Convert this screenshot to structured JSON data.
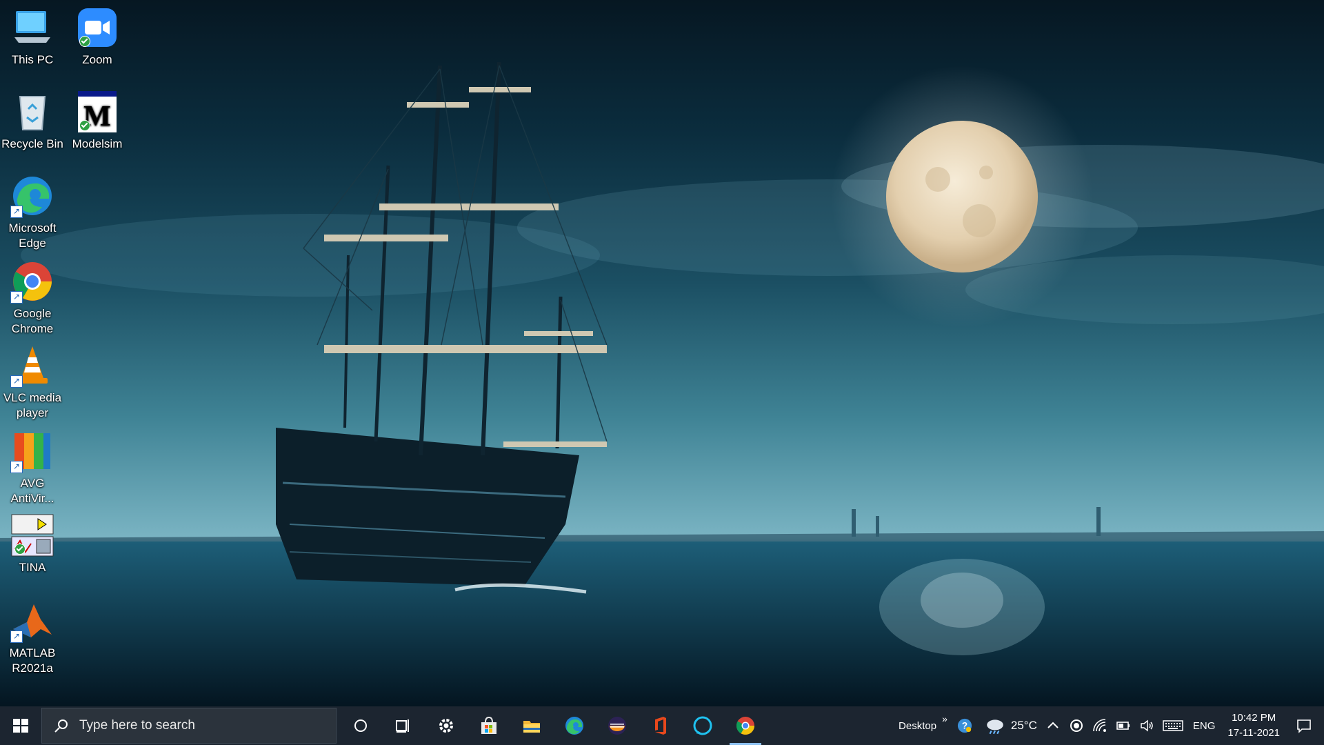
{
  "desktop": {
    "icons": [
      {
        "label": "This PC"
      },
      {
        "label": "Zoom"
      },
      {
        "label": "Recycle Bin"
      },
      {
        "label": "Modelsim"
      },
      {
        "label": "Microsoft Edge"
      },
      {
        "label": "Google Chrome"
      },
      {
        "label": "VLC media player"
      },
      {
        "label": "AVG AntiVir..."
      },
      {
        "label": "TINA"
      },
      {
        "label": "MATLAB R2021a"
      }
    ]
  },
  "taskbar": {
    "search_placeholder": "Type here to search",
    "pinned": [
      "cortana-icon",
      "task-view-icon",
      "settings-icon",
      "store-icon",
      "file-explorer-icon",
      "edge-icon",
      "eclipse-icon",
      "office-icon",
      "alexa-icon",
      "chrome-icon"
    ],
    "toolbar_label": "Desktop",
    "toolbar_chevron": "»",
    "weather_temp": "25°C",
    "language": "ENG",
    "time": "10:42 PM",
    "date": "17-11-2021"
  },
  "colors": {
    "taskbar_bg": "#1c2530",
    "active_indicator": "#8cc0f0"
  }
}
